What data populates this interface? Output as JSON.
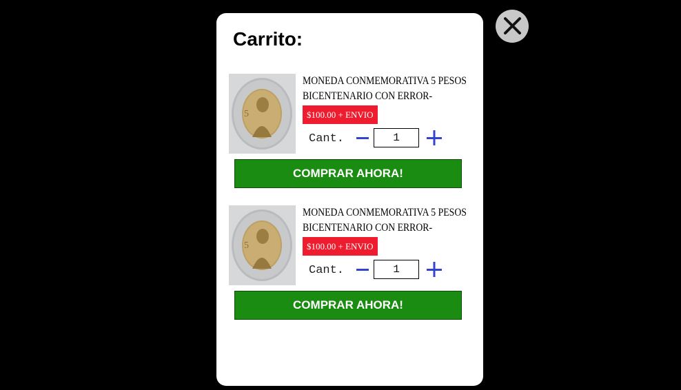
{
  "cart": {
    "title": "Carrito:",
    "close_icon": "close-icon",
    "items": [
      {
        "name": "MONEDA CONMEMORATIVA 5 PESOS BICENTENARIO CON ERROR-MEXICO-",
        "price": "$100.00 + ENVIO",
        "qty_label": "Cant.",
        "qty_value": "1",
        "buy_label": "COMPRAR AHORA!",
        "image": "coin-image"
      },
      {
        "name": "MONEDA CONMEMORATIVA 5 PESOS BICENTENARIO CON ERROR-MEXICO-",
        "price": "$100.00 + ENVIO",
        "qty_label": "Cant.",
        "qty_value": "1",
        "buy_label": "COMPRAR AHORA!",
        "image": "coin-image"
      }
    ]
  },
  "colors": {
    "backdrop": "#000000",
    "modal": "#ffffff",
    "price_badge": "#ee1c2e",
    "buy_button": "#1b8c12",
    "qty_controls": "#3344cc",
    "close_button": "#c8c8c8"
  }
}
